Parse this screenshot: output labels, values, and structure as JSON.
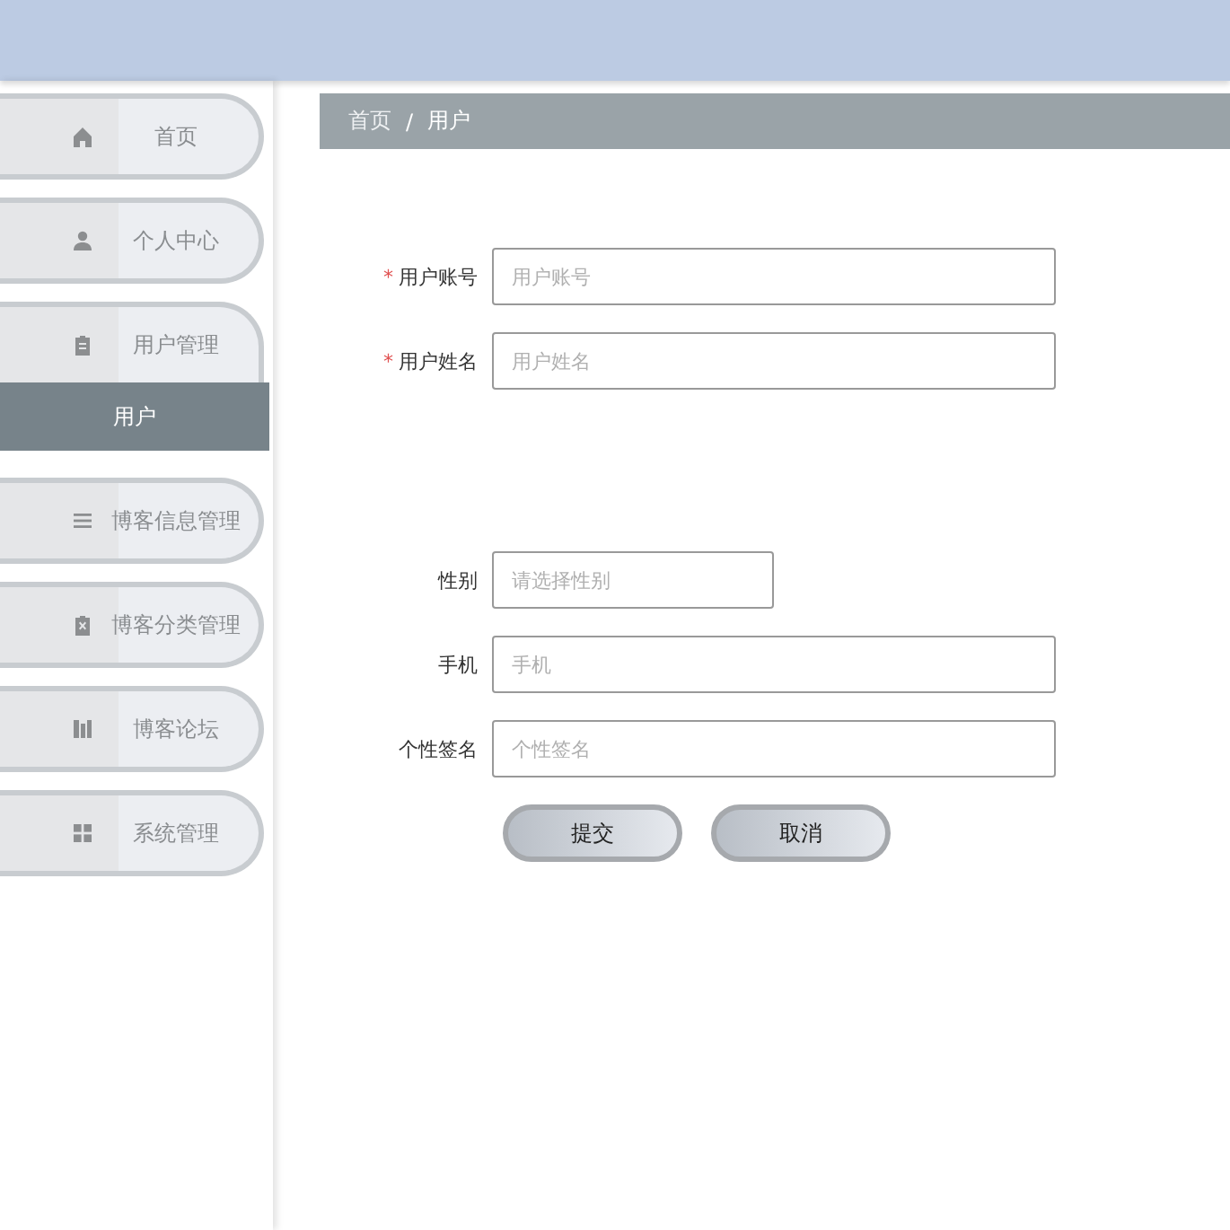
{
  "sidebar": {
    "items": [
      {
        "label": "首页",
        "selected": false
      },
      {
        "label": "个人中心",
        "selected": false
      },
      {
        "label": "用户管理",
        "selected": false,
        "expanded": true,
        "children": [
          {
            "label": "用户",
            "selected": true
          }
        ]
      },
      {
        "label": "博客信息管理",
        "selected": false
      },
      {
        "label": "博客分类管理",
        "selected": false
      },
      {
        "label": "博客论坛",
        "selected": false
      },
      {
        "label": "系统管理",
        "selected": false
      }
    ]
  },
  "breadcrumb": {
    "items": [
      "首页",
      "用户"
    ],
    "separator": "/"
  },
  "required_mark": "*",
  "form": {
    "fields": [
      {
        "kind": "input",
        "label": "用户账号",
        "placeholder": "用户账号",
        "required": true
      },
      {
        "kind": "input",
        "label": "用户姓名",
        "placeholder": "用户姓名",
        "required": true
      },
      {
        "kind": "select",
        "label": "性别",
        "placeholder": "请选择性别",
        "required": false
      },
      {
        "kind": "input",
        "label": "手机",
        "placeholder": "手机",
        "required": false
      },
      {
        "kind": "input",
        "label": "个性签名",
        "placeholder": "个性签名",
        "required": false
      }
    ],
    "buttons": [
      "提交",
      "取消"
    ]
  }
}
